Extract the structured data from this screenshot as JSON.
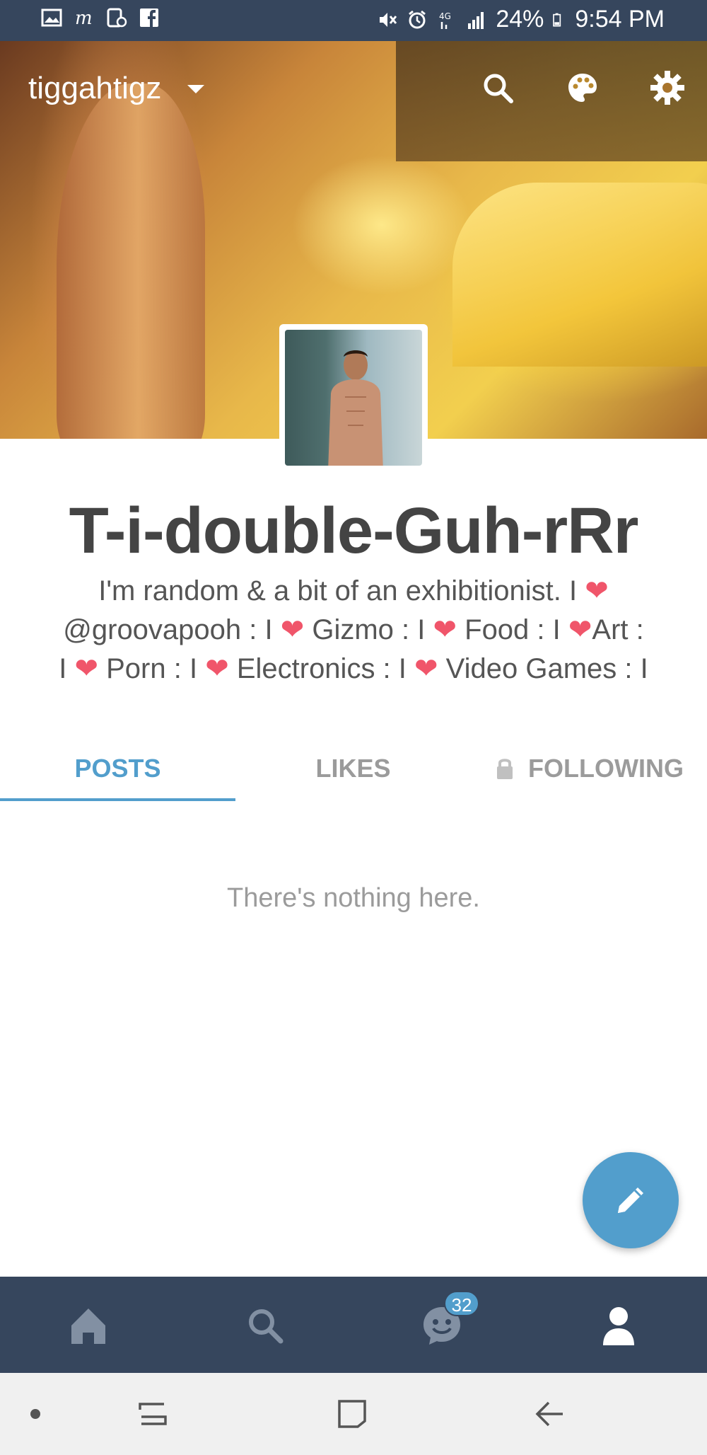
{
  "status_bar": {
    "battery": "24%",
    "time": "9:54 PM",
    "network": "4G"
  },
  "header": {
    "blog_name": "tiggahtigz",
    "icons": [
      "search-icon",
      "palette-icon",
      "gear-icon"
    ]
  },
  "profile": {
    "title": "T-i-double-Guh-rRr",
    "description_lines": [
      [
        "I'm random & a bit of an exhibitionist. I ",
        "heart",
        ""
      ],
      [
        "@groovapooh : I ",
        "heart",
        " Gizmo : I ",
        "heart",
        " Food : I ",
        "heart",
        "Art :"
      ],
      [
        "I ",
        "heart",
        " Porn : I ",
        "heart",
        " Electronics : I ",
        "heart",
        " Video Games : I"
      ]
    ]
  },
  "tabs": [
    {
      "label": "POSTS",
      "active": true
    },
    {
      "label": "LIKES",
      "active": false
    },
    {
      "label": "FOLLOWING",
      "active": false,
      "locked": true
    }
  ],
  "empty_state": "There's nothing here.",
  "bottom_nav": {
    "items": [
      "home-icon",
      "search-icon",
      "activity-icon",
      "account-icon"
    ],
    "activity_badge": "32"
  },
  "colors": {
    "status_bar": "#36465d",
    "accent": "#529ecc",
    "title": "#444444",
    "heart": "#f0556a"
  }
}
